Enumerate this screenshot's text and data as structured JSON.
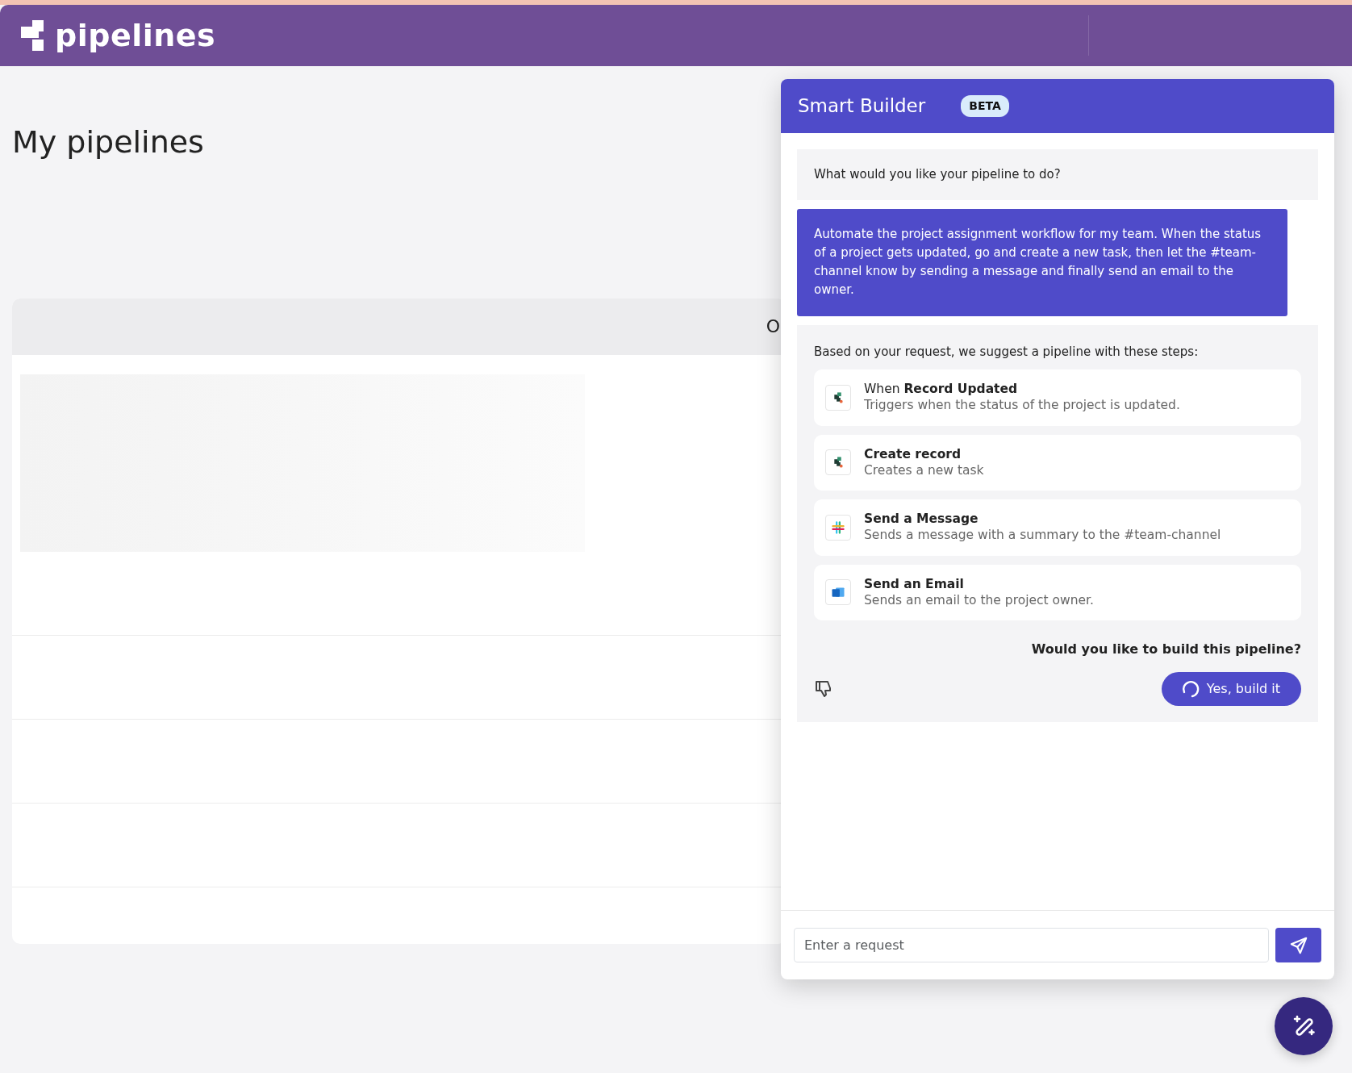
{
  "app": {
    "logo_text": "pipelines"
  },
  "page": {
    "title": "My pipelines"
  },
  "table": {
    "column_header": "O"
  },
  "smart_builder": {
    "title": "Smart Builder",
    "badge": "BETA",
    "messages": [
      {
        "kind": "bot",
        "text": "What would you like your pipeline to do?"
      },
      {
        "kind": "user",
        "text": "Automate the project assignment workflow for my team. When the status of a project gets updated, go and create a new task, then let the #team-channel know by sending a message and finally send an email to the owner."
      }
    ],
    "suggestion": {
      "intro": "Based on your request, we suggest a pipeline with these steps:",
      "steps": [
        {
          "kind": "record",
          "prefix": "When",
          "title": "Record Updated",
          "description": "Triggers when the status of the project is updated."
        },
        {
          "kind": "record",
          "title": "Create record",
          "description": "Creates a new task"
        },
        {
          "kind": "message",
          "title": "Send a Message",
          "description": "Sends a message with a summary to the #team-channel"
        },
        {
          "kind": "email",
          "title": "Send an Email",
          "description": "Sends an email to the project owner."
        }
      ],
      "question": "Would you like to build this pipeline?",
      "build_button": {
        "label": "Yes, build it",
        "loading": true
      }
    },
    "input": {
      "placeholder": "Enter a request"
    }
  }
}
